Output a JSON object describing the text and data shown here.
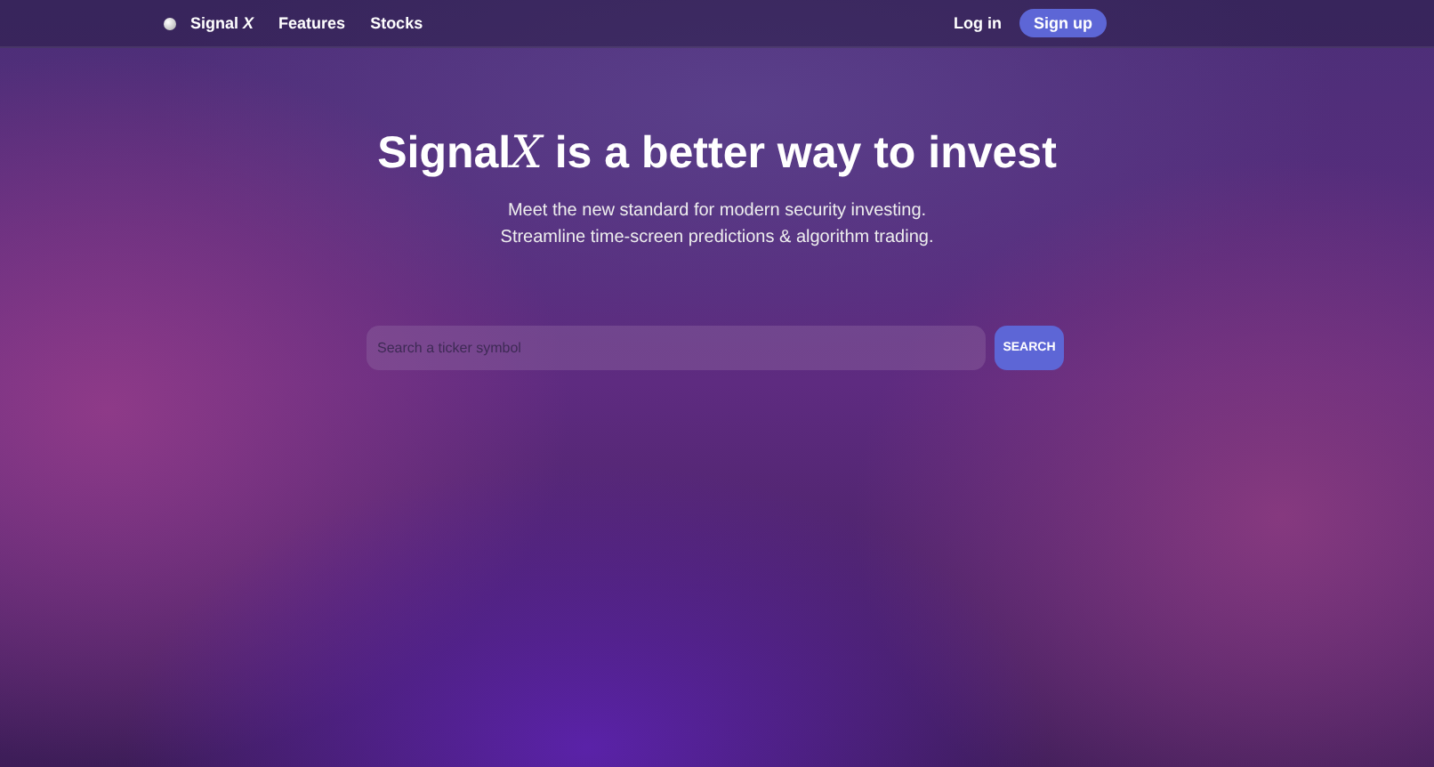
{
  "nav": {
    "brand": "Signal *X*",
    "links": [
      {
        "label": "Features"
      },
      {
        "label": "Stocks"
      }
    ],
    "login": "Log in",
    "signup": "Sign up"
  },
  "hero": {
    "title": {
      "brand": "Signal",
      "symbol": "X",
      "rest": "is a better way to invest"
    },
    "subtitle_lines": [
      "Meet the new standard for modern security investing.",
      "Streamline time-screen predictions & algorithm trading."
    ]
  },
  "search": {
    "placeholder": "Search a ticker symbol",
    "button": "SEARCH"
  }
}
